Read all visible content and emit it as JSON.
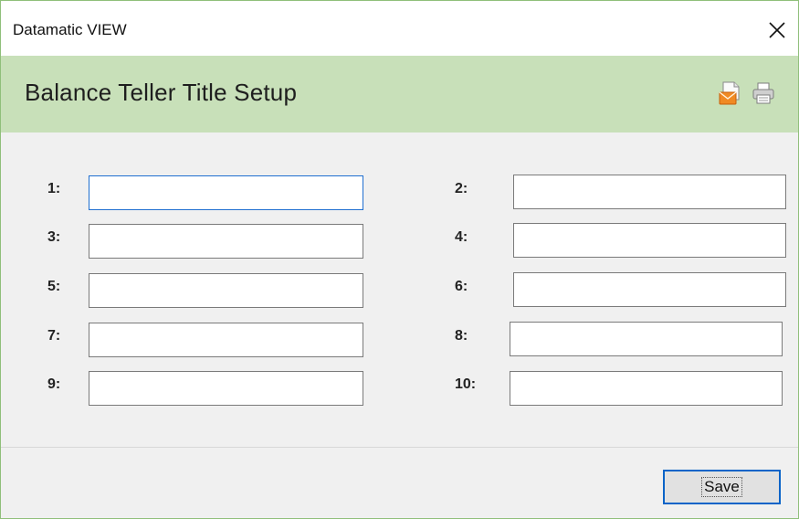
{
  "window": {
    "app_title": "Datamatic VIEW",
    "close_icon": "close-icon"
  },
  "header": {
    "title": "Balance Teller Title Setup",
    "icons": [
      "mail-export-icon",
      "print-icon"
    ],
    "bg_color": "#c8e0b9"
  },
  "fields": [
    {
      "label": "1:",
      "value": "",
      "focused": true
    },
    {
      "label": "2:",
      "value": ""
    },
    {
      "label": "3:",
      "value": ""
    },
    {
      "label": "4:",
      "value": ""
    },
    {
      "label": "5:",
      "value": ""
    },
    {
      "label": "6:",
      "value": ""
    },
    {
      "label": "7:",
      "value": ""
    },
    {
      "label": "8:",
      "value": ""
    },
    {
      "label": "9:",
      "value": ""
    },
    {
      "label": "10:",
      "value": ""
    }
  ],
  "footer": {
    "save_label": "Save"
  }
}
